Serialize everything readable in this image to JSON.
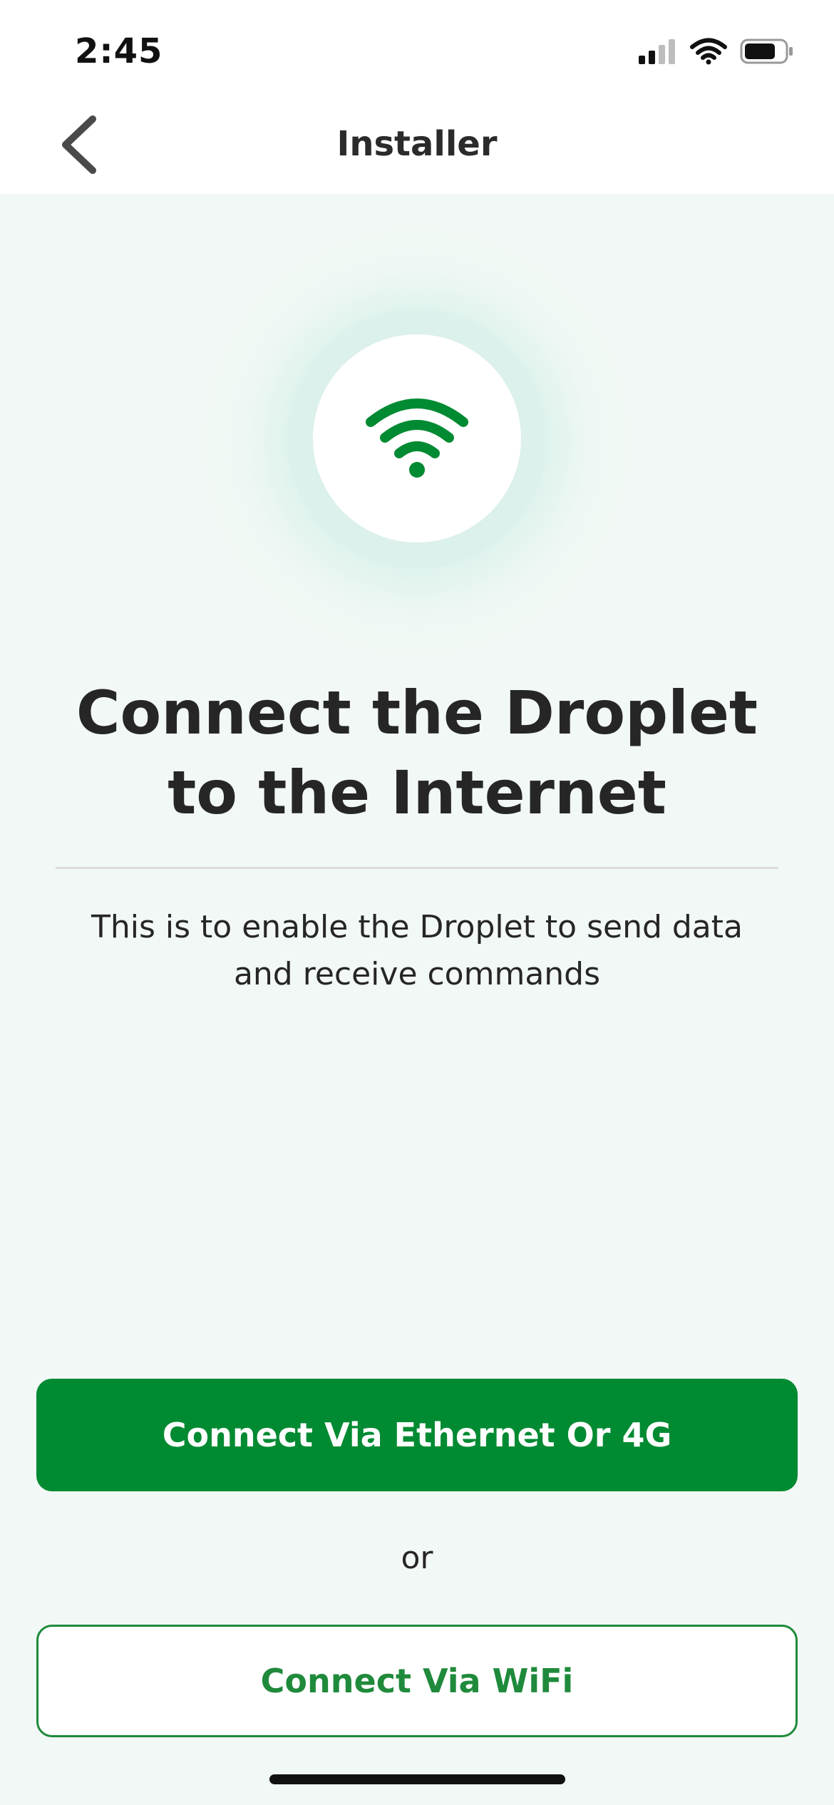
{
  "status_bar": {
    "time": "2:45",
    "icons": [
      "cellular-signal-icon",
      "wifi-icon",
      "battery-icon"
    ]
  },
  "nav": {
    "title": "Installer",
    "back_icon": "chevron-left-icon"
  },
  "hero": {
    "icon": "wifi-icon",
    "icon_color": "#008a32"
  },
  "content": {
    "heading": "Connect the Droplet to the Internet",
    "subtitle": "This is to enable the Droplet to send data and receive commands"
  },
  "actions": {
    "primary_label": "Connect Via Ethernet Or 4G",
    "separator": "or",
    "secondary_label": "Connect Via WiFi"
  },
  "colors": {
    "brand_green": "#008a32",
    "background": "#f2f8f5",
    "text": "#262626"
  }
}
